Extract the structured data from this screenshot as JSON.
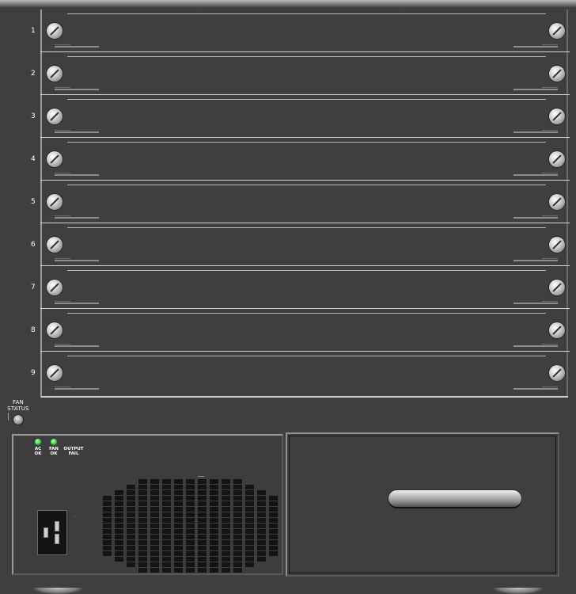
{
  "chassis": {
    "slots": [
      {
        "number": "1"
      },
      {
        "number": "2"
      },
      {
        "number": "3"
      },
      {
        "number": "4"
      },
      {
        "number": "5"
      },
      {
        "number": "6"
      },
      {
        "number": "7"
      },
      {
        "number": "8"
      },
      {
        "number": "9"
      }
    ]
  },
  "fan": {
    "label_line1": "FAN",
    "label_line2": "STATUS"
  },
  "power_supply": {
    "leds": [
      {
        "line1": "AC",
        "line2": "OK",
        "color": "#33cc33"
      },
      {
        "line1": "FAN",
        "line2": "OK",
        "color": "#33cc33"
      }
    ],
    "output_fail_line1": "OUTPUT",
    "output_fail_line2": "FAIL"
  },
  "colors": {
    "chassis": "#3f3f3f",
    "led_ok": "#33cc33"
  }
}
